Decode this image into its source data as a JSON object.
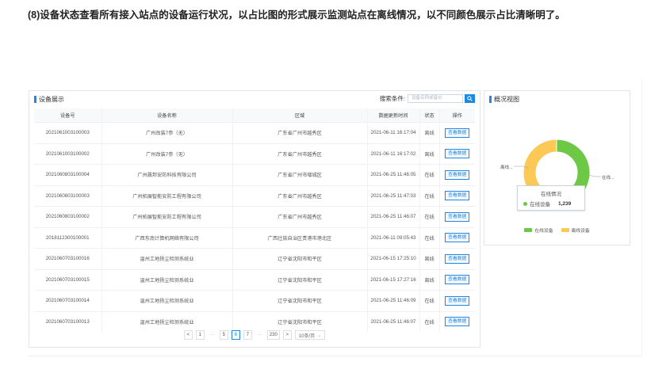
{
  "caption": "(8)设备状态查看所有接入站点的设备运行状况，以占比图的形式展示监测站点在离线情况，以不同颜色展示占比清晰明了。",
  "device_panel": {
    "title": "设备展示",
    "search_label": "搜索条件:",
    "search_placeholder": "设备名称或者ID",
    "columns": [
      "设备号",
      "设备名称",
      "区域",
      "数据更新时间",
      "状态",
      "操作"
    ],
    "rows": [
      {
        "id": "2021061003100003",
        "name": "广州改装7参（无）",
        "region": "广东省广州市越秀区",
        "time": "2021-06-11 16:17:04",
        "status": "离线",
        "action": "查看数据"
      },
      {
        "id": "2021061003100002",
        "name": "广州改装7参（无）",
        "region": "广东省广州市越秀区",
        "time": "2021-06-11 16:17:02",
        "status": "离线",
        "action": "查看数据"
      },
      {
        "id": "2021060803100004",
        "name": "广州晨邦安防科技有限公司",
        "region": "广东省广州市增城区",
        "time": "2021-06-25 11:46:05",
        "status": "在线",
        "action": "查看数据"
      },
      {
        "id": "2021060803100003",
        "name": "广州拓展智能安防工程有限公司",
        "region": "广东省广州市越秀区",
        "time": "2021-06-25 11:47:03",
        "status": "在线",
        "action": "查看数据"
      },
      {
        "id": "2021060803100002",
        "name": "广州拓展智能安防工程有限公司",
        "region": "广东省广州市越秀区",
        "time": "2021-06-25 11:46:07",
        "status": "在线",
        "action": "查看数据"
      },
      {
        "id": "2018112300100001",
        "name": "广西东南计算机网络有限公司",
        "region": "广西壮族自治区贵港市港北区",
        "time": "2021-06-11 09:05:43",
        "status": "在线",
        "action": "查看数据"
      },
      {
        "id": "2021060703100016",
        "name": "温州工地扬尘检测系统业",
        "region": "辽宁省沈阳市和平区",
        "time": "2021-06-15 17:25:10",
        "status": "离线",
        "action": "查看数据"
      },
      {
        "id": "2021060703100015",
        "name": "温州工地扬尘检测系统业",
        "region": "辽宁省沈阳市和平区",
        "time": "2021-06-15 17:27:16",
        "status": "离线",
        "action": "查看数据"
      },
      {
        "id": "2021060703100014",
        "name": "温州工地扬尘检测系统业",
        "region": "辽宁省沈阳市和平区",
        "time": "2021-06-25 11:46:09",
        "status": "在线",
        "action": "查看数据"
      },
      {
        "id": "2021060703100013",
        "name": "温州工地扬尘检测系统业",
        "region": "辽宁省沈阳市和平区",
        "time": "2021-06-25 11:46:07",
        "status": "在线",
        "action": "查看数据"
      }
    ],
    "pagination": {
      "prev": "<",
      "first": "1",
      "ellipsis_left": "···",
      "p5": "5",
      "current": "6",
      "p7": "7",
      "ellipsis_right": "···",
      "last": "230",
      "next": ">",
      "page_size": "10条/页"
    }
  },
  "overview_panel": {
    "title": "概况视图",
    "tooltip": {
      "title": "在线情况",
      "series": "在线设备",
      "value": "1,239"
    },
    "label_offline": "离线...",
    "label_online": "在线...",
    "legend": {
      "online": "在线设备",
      "offline": "离线设备"
    }
  },
  "chart_data": {
    "type": "pie",
    "donut": true,
    "categories": [
      "在线设备",
      "离线设备"
    ],
    "values": [
      1239,
      1100
    ],
    "colors": [
      "#6dc845",
      "#fcc956"
    ],
    "legend_placement": "bottom"
  }
}
